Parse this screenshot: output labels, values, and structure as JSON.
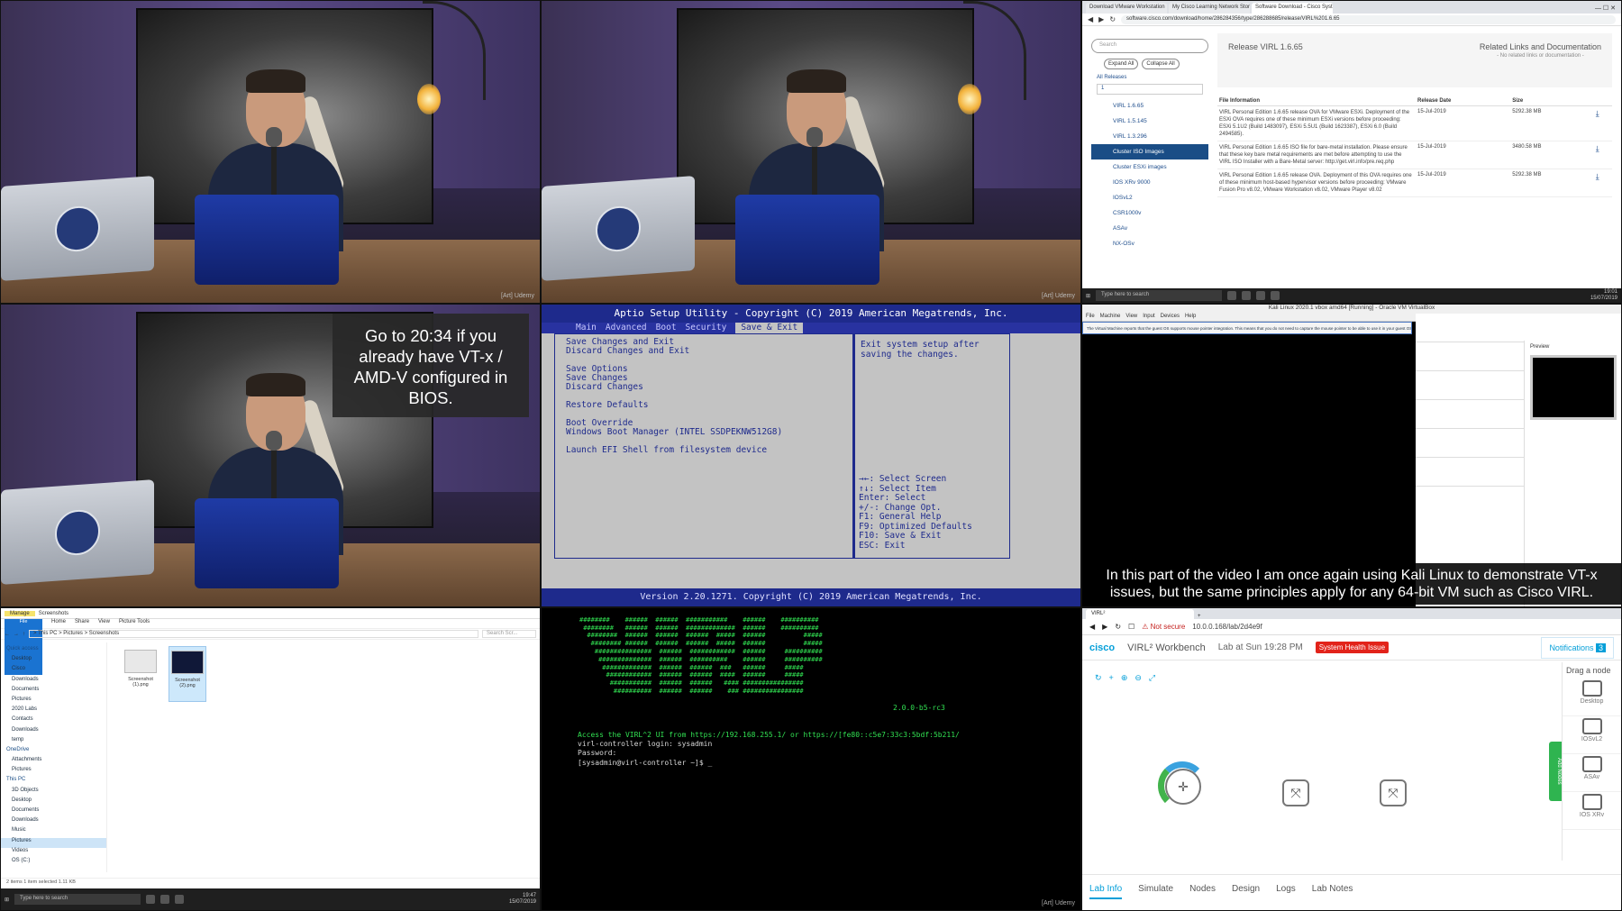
{
  "caption_top": "Go to 20:34 if you already have VT-x / AMD-V configured in BIOS.",
  "caption_bottom": "In this part of the video I am once again using Kali Linux to demonstrate VT-x issues, but the same principles apply for any 64-bit VM such as Cisco VIRL.",
  "video": {
    "brand": "[Art] Udemy"
  },
  "browser": {
    "tabs": [
      "Download VMware Workstation",
      "My Cisco Learning Network Store",
      "Software Download - Cisco Systems"
    ],
    "url": "software.cisco.com/download/home/286284356/type/286288685/release/VIRL%201.6.65",
    "search_placeholder": "Search",
    "expand_all": "Expand All",
    "collapse_all": "Collapse All",
    "all_releases": "All Releases",
    "tree": [
      "VIRL 1.6.65",
      "VIRL 1.5.145",
      "VIRL 1.3.296",
      "Cluster ISO Images",
      "Cluster ESXi images",
      "IOS XRv 9000",
      "IOSvL2",
      "CSR1000v",
      "ASAv",
      "NX-OSv"
    ],
    "active_tree_index": 3,
    "release_title": "Release VIRL 1.6.65",
    "related_title": "Related Links and Documentation",
    "related_none": "- No related links or documentation -",
    "col_info": "File Information",
    "col_date": "Release Date",
    "col_size": "Size",
    "rows": [
      {
        "desc": "VIRL Personal Edition 1.6.65 release OVA for VMware ESXi. Deployment of the ESXi OVA requires one of these minimum ESXi versions before proceeding: ESXi 5.1U2 (Build 1483097), ESXi 5.5U1 (Build 1623387), ESXi 6.0 (Build 2494585).",
        "date": "15-Jul-2019",
        "size": "5292.38 MB"
      },
      {
        "desc": "VIRL Personal Edition 1.6.65 ISO file for bare-metal installation. Please ensure that these key bare metal requirements are met before attempting to use the VIRL ISO Installer with a Bare-Metal server: http://get.virl.info/pre.req.php",
        "date": "15-Jul-2019",
        "size": "3480.58 MB"
      },
      {
        "desc": "VIRL Personal Edition 1.6.65 release OVA. Deployment of this OVA requires one of these minimum host-based hypervisor versions before proceeding: VMware Fusion Pro v8.02, VMware Workstation v8.02, VMware Player v8.02",
        "date": "15-Jul-2019",
        "size": "5292.38 MB"
      }
    ],
    "taskbar_search": "Type here to search",
    "clock_time": "19:01",
    "clock_date": "15/07/2019"
  },
  "bios": {
    "title": "Aptio Setup Utility - Copyright (C) 2019 American Megatrends, Inc.",
    "menu": [
      "Main",
      "Advanced",
      "Boot",
      "Security",
      "Save & Exit"
    ],
    "active_menu_index": 4,
    "items": [
      "Save Changes and Exit",
      "Discard Changes and Exit",
      "",
      "Save Options",
      "Save Changes",
      "Discard Changes",
      "",
      "Restore Defaults",
      "",
      "Boot Override",
      "Windows Boot Manager (INTEL SSDPEKNW512G8)",
      "",
      "Launch EFI Shell from filesystem device"
    ],
    "help": "Exit system setup after saving the changes.",
    "keys": [
      "→←: Select Screen",
      "↑↓: Select Item",
      "Enter: Select",
      "+/-: Change Opt.",
      "F1: General Help",
      "F9: Optimized Defaults",
      "F10: Save & Exit",
      "ESC: Exit"
    ],
    "footer": "Version 2.20.1271. Copyright (C) 2019 American Megatrends, Inc."
  },
  "vbox": {
    "title": "Kali Linux 2020.1 vbox amd64 [Running] - Oracle VM VirtualBox",
    "menu": [
      "File",
      "Machine",
      "View",
      "Input",
      "Devices",
      "Help"
    ],
    "notice": "The Virtual Machine reports that the guest OS supports mouse pointer integration. This means that you do not need to capture the mouse pointer to be able to use it in your guest OS",
    "preview": "Preview"
  },
  "explorer": {
    "manage": "Manage",
    "title": "Screenshots",
    "ribbon": [
      "File",
      "Home",
      "Share",
      "View",
      "Picture Tools"
    ],
    "breadcrumb": "> This PC > Pictures > Screenshots",
    "search": "Search Scr...",
    "nav": [
      "Quick access",
      "Desktop",
      "Cisco",
      "Downloads",
      "Documents",
      "Pictures",
      "2020 Labs",
      "Contacts",
      "Downloads",
      "temp",
      "OneDrive",
      "Attachments",
      "Pictures",
      "This PC",
      "3D Objects",
      "Desktop",
      "Documents",
      "Downloads",
      "Music",
      "Pictures",
      "Videos",
      "OS (C:)"
    ],
    "selected_nav_index": 19,
    "files": [
      "Screenshot (1).png",
      "Screenshot (2).png"
    ],
    "status": "2 items    1 item selected 1.11 KB",
    "taskbar_search": "Type here to search",
    "clock_time": "19:47",
    "clock_date": "15/07/2019"
  },
  "console": {
    "version": "2.0.0-b5-rc3",
    "lines": [
      "Access the VIRL^2 UI from https://192.168.255.1/ or https://[fe80::c5e7:33c3:5bdf:5b211/",
      "virl-controller login: sysadmin",
      "Password:",
      "[sysadmin@virl-controller ~]$ _"
    ]
  },
  "virl": {
    "tab": "VIRL²",
    "not_secure": "Not secure",
    "url": "10.0.0.168/lab/2d4e9f",
    "logo": "cisco",
    "product": "VIRL² Workbench",
    "lab": "Lab at Sun 19:28 PM",
    "health": "System Health Issue",
    "notifications": "Notifications",
    "notif_count": "3",
    "palette_title": "Drag a node",
    "palette": [
      "Desktop",
      "IOSvL2",
      "ASAv",
      "IOS XRv"
    ],
    "add_nodes": "Add Nodes",
    "bottom_tabs": [
      "Lab Info",
      "Simulate",
      "Nodes",
      "Design",
      "Logs",
      "Lab Notes"
    ],
    "active_bottom_index": 0
  }
}
